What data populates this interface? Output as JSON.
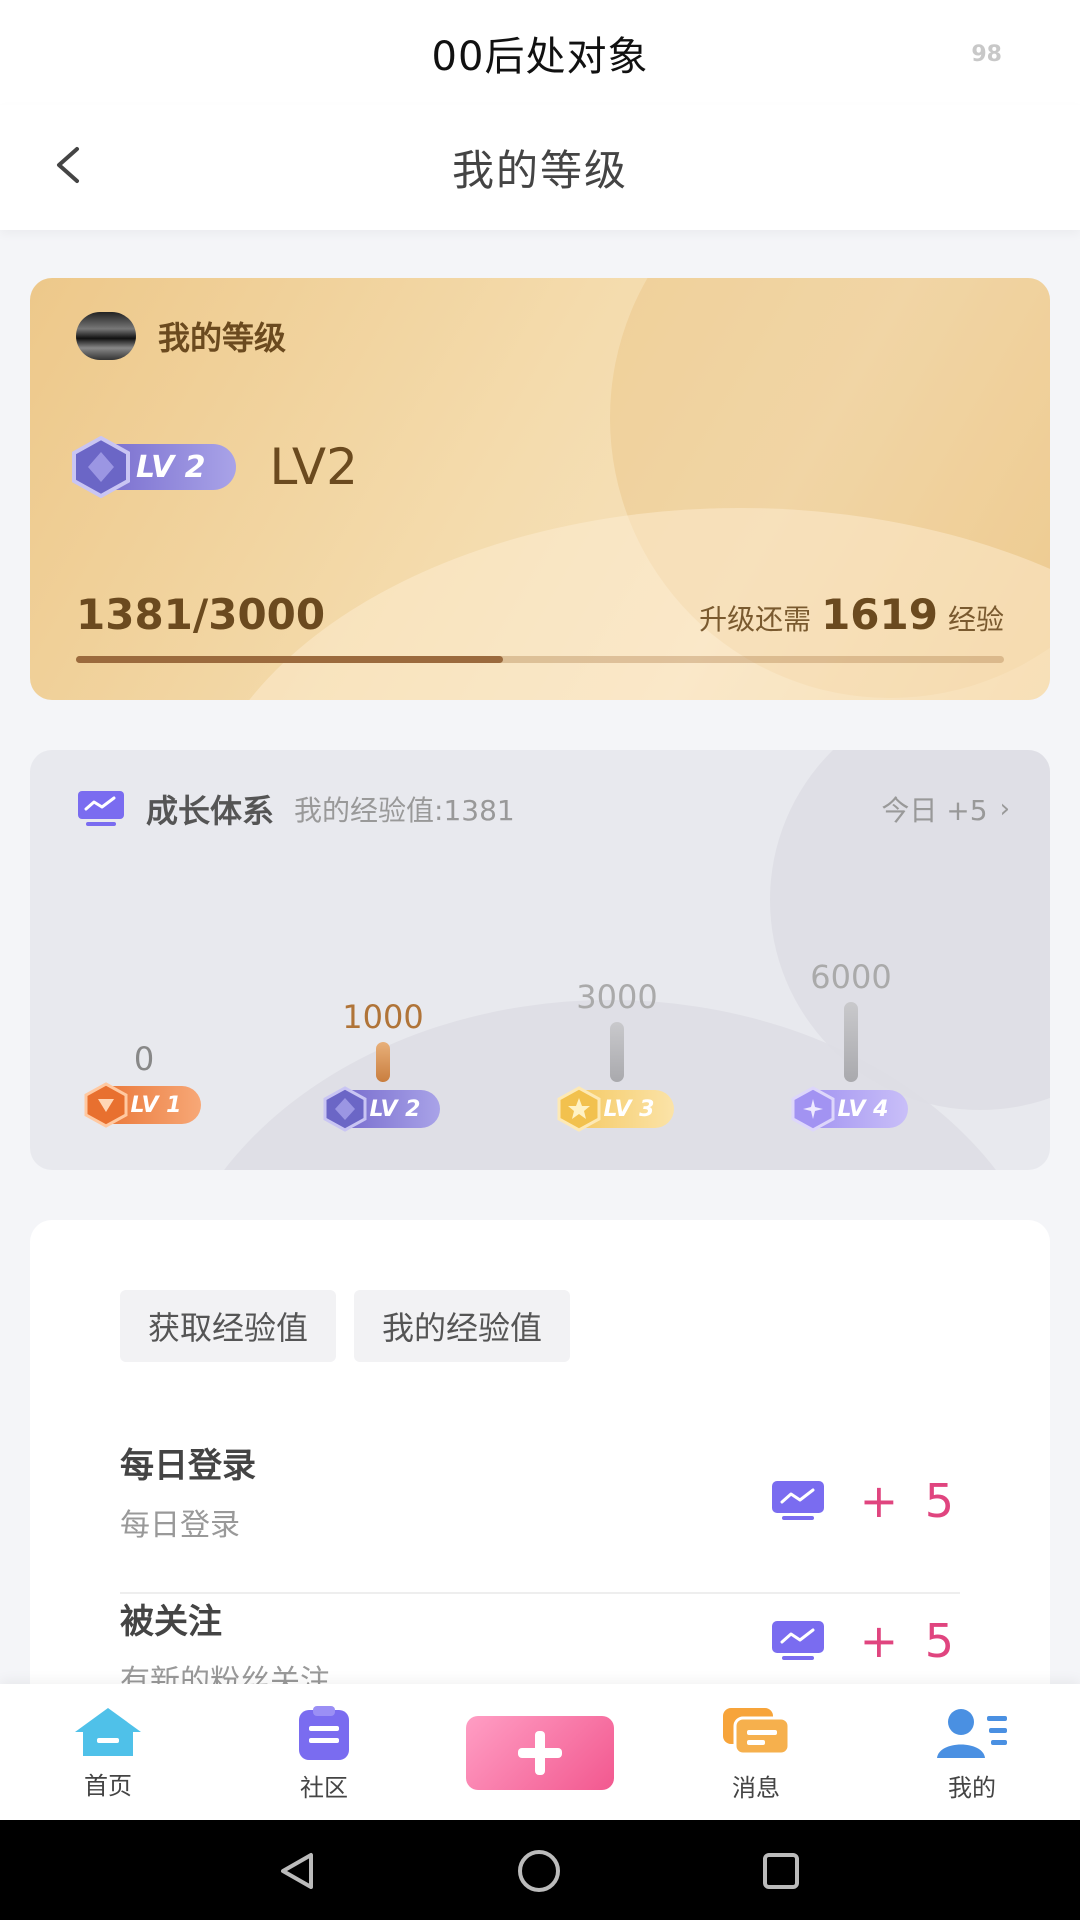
{
  "status_bar": {
    "title": "00后处对象",
    "battery": "98"
  },
  "header": {
    "title": "我的等级"
  },
  "level_card": {
    "title": "我的等级",
    "badge_label": "LV 2",
    "level_text": "LV2",
    "exp_current": "1381/3000",
    "need_prefix": "升级还需",
    "need_value": "1619",
    "need_suffix": "经验",
    "progress_fraction": 0.46
  },
  "growth": {
    "title": "成长体系",
    "subtitle": "我的经验值:1381",
    "today": "今日 +5",
    "levels": [
      {
        "value": "0",
        "badge": "LV 1",
        "color": "#f07a3c"
      },
      {
        "value": "1000",
        "badge": "LV 2",
        "color": "#7b7fd4"
      },
      {
        "value": "3000",
        "badge": "LV 3",
        "color": "#f7cf72"
      },
      {
        "value": "6000",
        "badge": "LV 4",
        "color": "#a99bf0"
      }
    ]
  },
  "tasks": {
    "tabs": [
      "获取经验值",
      "我的经验值"
    ],
    "items": [
      {
        "title": "每日登录",
        "desc": "每日登录",
        "points": "+ 5"
      },
      {
        "title": "被关注",
        "desc": "有新的粉丝关注",
        "points": "+ 5"
      }
    ]
  },
  "bottom_nav": {
    "items": [
      {
        "label": "首页"
      },
      {
        "label": "社区"
      },
      {
        "label": "消息"
      },
      {
        "label": "我的"
      }
    ]
  },
  "colors": {
    "accent_pink": "#e0457f",
    "level_gold": "#6b4a1f",
    "growth_icon": "#7a6cf0"
  }
}
